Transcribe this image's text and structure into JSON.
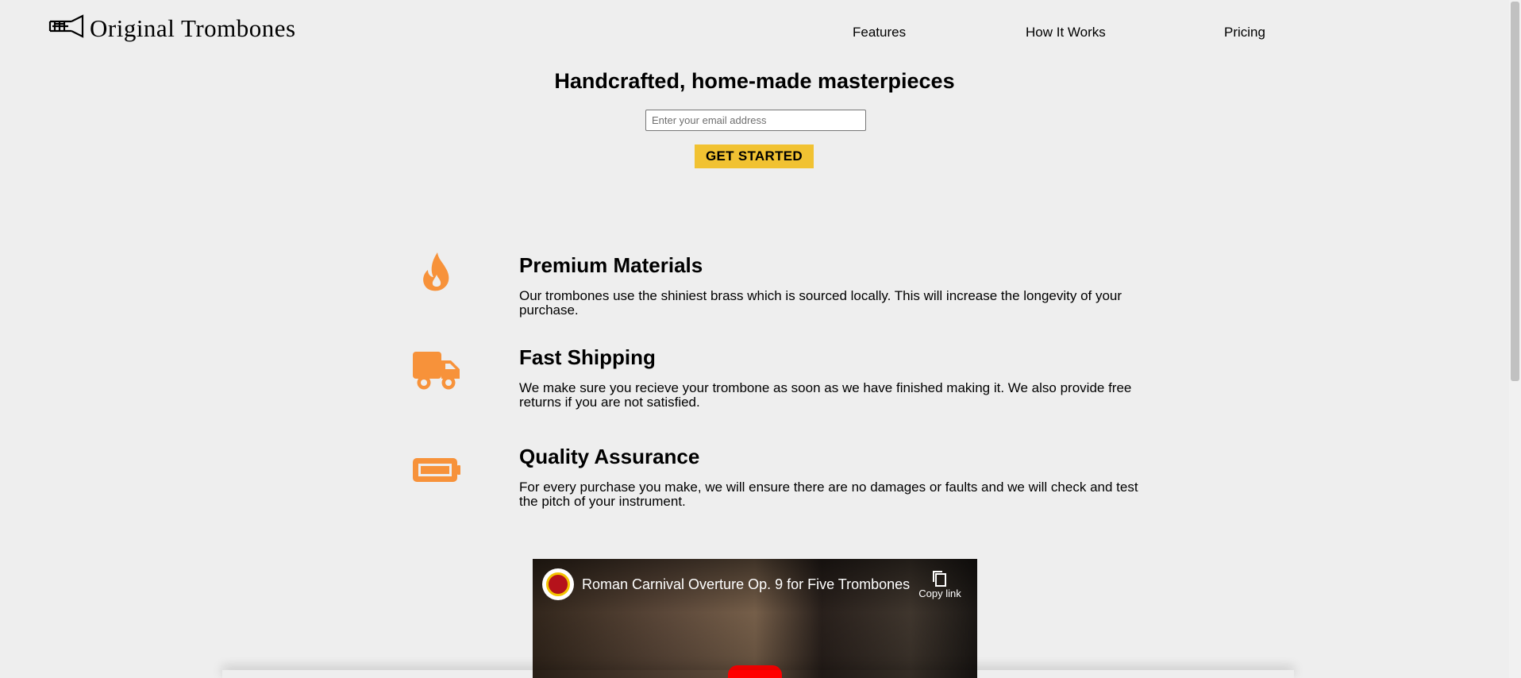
{
  "header": {
    "logo_text": "Original Trombones",
    "logo_icon": "trombone-icon",
    "nav": [
      {
        "label": "Features"
      },
      {
        "label": "How It Works"
      },
      {
        "label": "Pricing"
      }
    ]
  },
  "hero": {
    "title": "Handcrafted, home-made masterpieces",
    "email_placeholder": "Enter your email address",
    "cta_label": "GET STARTED"
  },
  "features": [
    {
      "icon": "fire-icon",
      "title": "Premium Materials",
      "description": "Our trombones use the shiniest brass which is sourced locally. This will increase the longevity of your purchase."
    },
    {
      "icon": "truck-icon",
      "title": "Fast Shipping",
      "description": "We make sure you recieve your trombone as soon as we have finished making it. We also provide free returns if you are not satisfied."
    },
    {
      "icon": "battery-icon",
      "title": "Quality Assurance",
      "description": "For every purchase you make, we will ensure there are no damages or faults and we will check and test the pitch of your instrument."
    }
  ],
  "video": {
    "title": "Roman Carnival Overture Op. 9 for Five Trombones",
    "copy_link_label": "Copy link"
  },
  "colors": {
    "accent": "#f1c232",
    "icon": "#f7923a",
    "background": "#eeeeee"
  }
}
